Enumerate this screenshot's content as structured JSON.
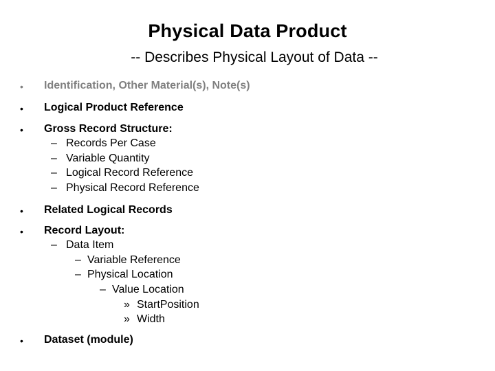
{
  "slide": {
    "title": "Physical Data Product",
    "subtitle": "-- Describes Physical Layout of Data --",
    "colors": {
      "text": "#000000",
      "dimmed": "#808080",
      "background": "#ffffff"
    },
    "bullet_glyph": "•",
    "dash_glyph": "–",
    "raquo_glyph": "»",
    "items": [
      {
        "label": "Identification, Other Material(s), Note(s)",
        "dimmed": true
      },
      {
        "label": "Logical Product Reference"
      },
      {
        "label": "Gross Record Structure:",
        "children": [
          "Records Per Case",
          "Variable Quantity",
          "Logical Record Reference",
          "Physical Record Reference"
        ]
      },
      {
        "label": "Related Logical Records"
      },
      {
        "label": "Record Layout:",
        "children": [
          {
            "label": "Data Item",
            "children": [
              {
                "label": "Variable Reference"
              },
              {
                "label": "Physical Location",
                "children": [
                  {
                    "label": "Value Location",
                    "children": [
                      "StartPosition",
                      "Width"
                    ]
                  }
                ]
              }
            ]
          }
        ]
      },
      {
        "label": "Dataset (module)"
      }
    ]
  }
}
